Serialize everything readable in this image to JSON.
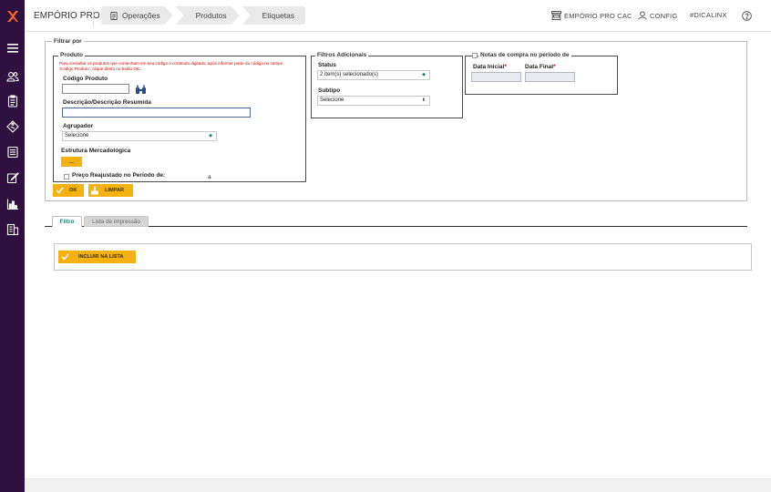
{
  "app": {
    "title": "EMPÓRIO PRO"
  },
  "breadcrumbs": [
    {
      "label": "Operações"
    },
    {
      "label": "Produtos"
    },
    {
      "label": "Etiquetas"
    }
  ],
  "header": {
    "links": [
      {
        "label": "EMPÓRIO PRO CAC"
      },
      {
        "label": "CONFIG"
      },
      {
        "label": "#DICALINX"
      }
    ]
  },
  "sidebar": {
    "icons": [
      "menu-icon",
      "users-icon",
      "clipboard-icon",
      "tag-icon",
      "list-icon",
      "edit-icon",
      "chart-icon",
      "building-icon"
    ]
  },
  "filter": {
    "legend": "Filtrar por",
    "produto": {
      "legend": "Produto",
      "hint": "Para consultar os produtos que contenham em seu código o conteúdo digitado, após informar parte do código no campo 'Código Produto', clique direto no botão OK.",
      "codigo_label": "Código Produto",
      "descricao_label": "Descrição/Descrição Resumida",
      "agrupador_label": "Agrupador",
      "agrupador_value": "Selecione",
      "estrutura_label": "Estrutura Mercadológica",
      "estrutura_button": "...",
      "preco_label": "Preço Reajustado no Período de:",
      "preco_sep": "a"
    },
    "adicionais": {
      "legend": "Filtros Adicionais",
      "status_label": "Status",
      "status_value": "2 item(s) selecionado(s)",
      "subtipo_label": "Subtipo",
      "subtipo_value": "Selecione"
    },
    "notas": {
      "legend": "Notas de compra no período de",
      "data_inicial_label": "Data Inicial",
      "data_final_label": "Data Final",
      "required_mark": "*"
    },
    "ok_button": "OK",
    "limpar_button": "LIMPAR"
  },
  "tabs": [
    {
      "label": "Filtro",
      "active": true
    },
    {
      "label": "Lista de impressão",
      "active": false
    }
  ],
  "incluir_button": "INCLUIR NA LISTA",
  "colors": {
    "sidebar": "#2e1140",
    "accent": "#f5b111",
    "brand_orange": "#f26522",
    "tab_active": "#1b7c74",
    "required": "#d00000"
  }
}
